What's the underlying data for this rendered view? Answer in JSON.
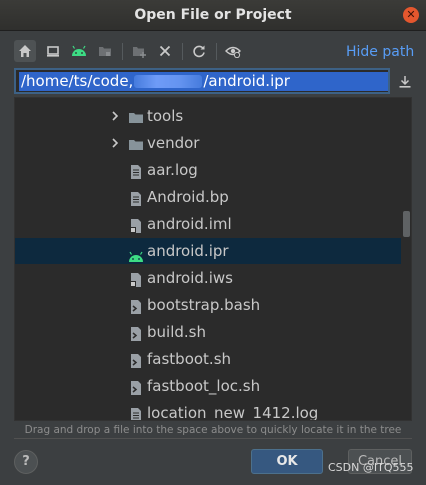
{
  "dialog": {
    "title": "Open File or Project",
    "close_icon": "close-icon"
  },
  "toolbar": {
    "buttons": [
      {
        "icon": "home-icon",
        "active": true
      },
      {
        "icon": "desktop-icon"
      },
      {
        "icon": "android-icon"
      },
      {
        "icon": "project-folder-icon"
      },
      {
        "icon": "new-folder-icon"
      },
      {
        "icon": "delete-icon"
      },
      {
        "icon": "refresh-icon"
      },
      {
        "icon": "show-hidden-icon"
      }
    ],
    "hide_path_label": "Hide path"
  },
  "path": {
    "prefix": "/home/ts/code,",
    "suffix": "/android.ipr"
  },
  "tree": {
    "items": [
      {
        "label": "tools",
        "type": "folder",
        "expandable": true
      },
      {
        "label": "vendor",
        "type": "folder",
        "expandable": true
      },
      {
        "label": "aar.log",
        "type": "text-file"
      },
      {
        "label": "Android.bp",
        "type": "text-file"
      },
      {
        "label": "android.iml",
        "type": "module-file"
      },
      {
        "label": "android.ipr",
        "type": "android-project",
        "selected": true
      },
      {
        "label": "android.iws",
        "type": "module-file"
      },
      {
        "label": "bootstrap.bash",
        "type": "script-file"
      },
      {
        "label": "build.sh",
        "type": "script-file"
      },
      {
        "label": "fastboot.sh",
        "type": "script-file"
      },
      {
        "label": "fastboot_loc.sh",
        "type": "script-file"
      },
      {
        "label": "location_new_1412.log",
        "type": "text-file"
      }
    ]
  },
  "hint": "Drag and drop a file into the space above to quickly locate it in the tree",
  "buttons": {
    "help_label": "?",
    "ok_label": "OK",
    "cancel_label": "Cancel"
  },
  "watermark": "CSDN @ITQ555",
  "colors": {
    "accent": "#589df6",
    "selection": "#2f65ca",
    "android_green": "#3ddc84",
    "panel": "#3c3f41",
    "tree_bg": "#2b2b2b"
  }
}
